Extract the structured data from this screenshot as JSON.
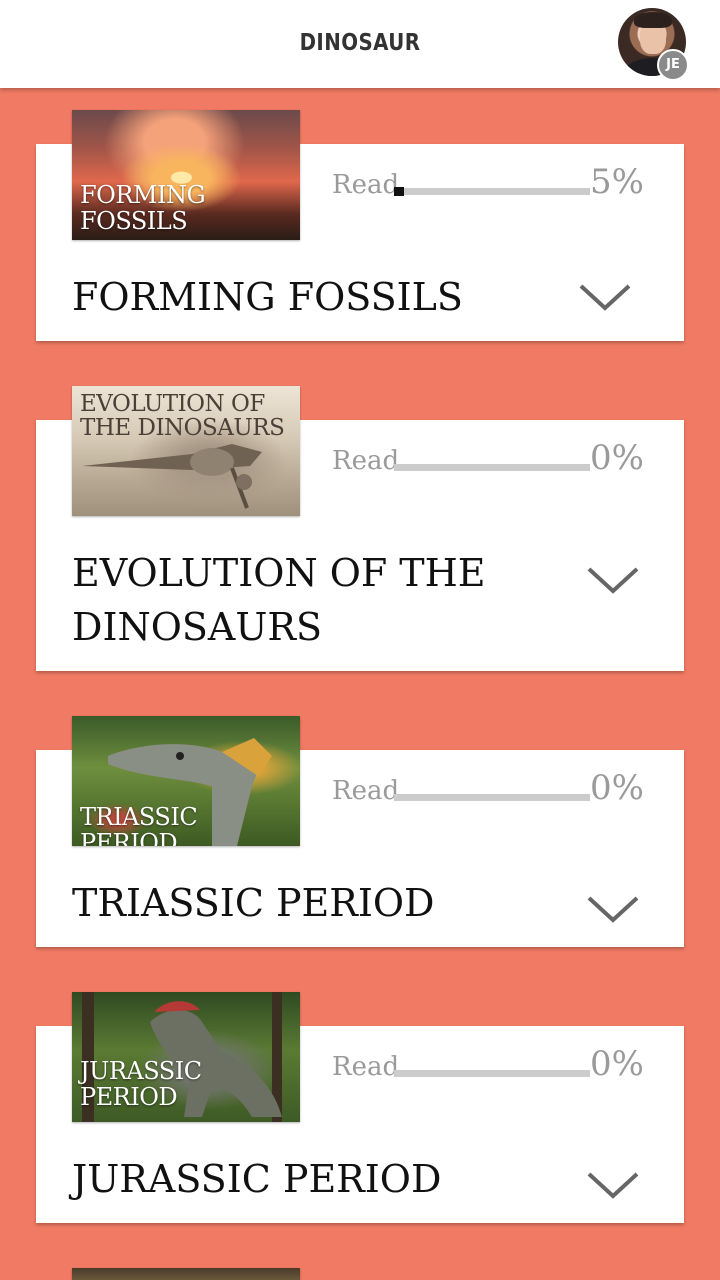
{
  "header": {
    "title": "DINOSAUR",
    "avatar_badge": "JE"
  },
  "read_label": "Read",
  "chapters": [
    {
      "thumb_caption": "FORMING FOSSILS",
      "title": "FORMING FOSSILS",
      "progress_text": "5%",
      "progress": 0.05
    },
    {
      "thumb_caption": "EVOLUTION OF THE DINOSAURS",
      "title": "EVOLUTION OF THE DINOSAURS",
      "progress_text": "0%",
      "progress": 0
    },
    {
      "thumb_caption": "TRIASSIC PERIOD",
      "title": "TRIASSIC PERIOD",
      "progress_text": "0%",
      "progress": 0
    },
    {
      "thumb_caption": "JURASSIC PERIOD",
      "title": "JURASSIC PERIOD",
      "progress_text": "0%",
      "progress": 0
    }
  ],
  "colors": {
    "background": "#f07a63",
    "card": "#ffffff",
    "progress_track": "#cccccc",
    "progress_fill": "#111111"
  },
  "icons": {
    "expand": "chevron-down-icon",
    "profile": "avatar"
  }
}
